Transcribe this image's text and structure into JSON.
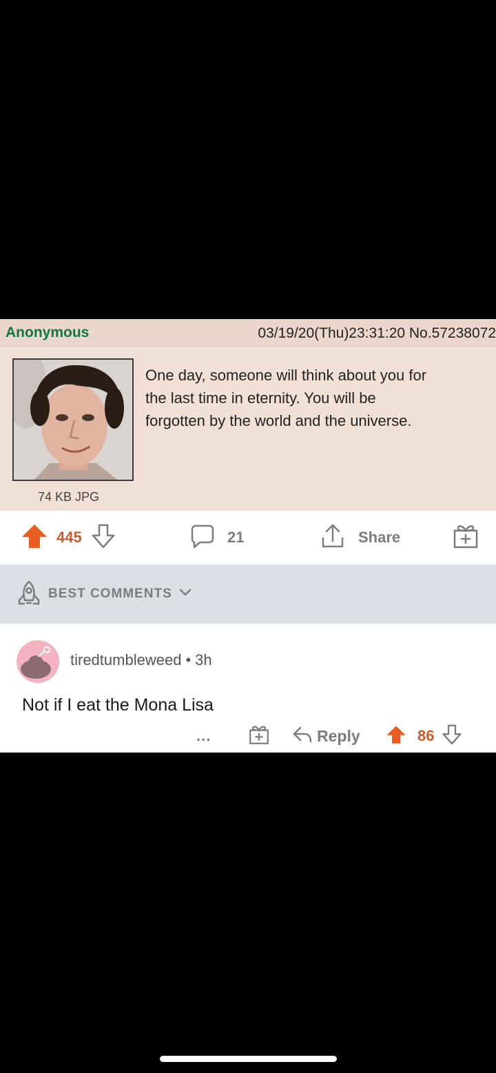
{
  "post": {
    "name": "Anonymous",
    "meta": "03/19/20(Thu)23:31:20 No.57238072",
    "text_lines": [
      "One day, someone will think about you for",
      "the last time in eternity. You will be",
      "forgotten by the world and the universe."
    ],
    "file_info": "74 KB JPG"
  },
  "actions": {
    "upvotes": "445",
    "comments": "21",
    "share_label": "Share",
    "upvote_color": "#cc5a2a"
  },
  "sort": {
    "label": "BEST COMMENTS"
  },
  "comment": {
    "username": "tiredtumbleweed",
    "separator": "•",
    "age": "3h",
    "body": "Not if I eat the Mona Lisa",
    "more": "...",
    "reply_label": "Reply",
    "votes": "86"
  },
  "icons": {
    "upvote": "arrow-up-icon",
    "downvote": "arrow-down-icon",
    "comment": "speech-bubble-icon",
    "share": "share-icon",
    "award": "gift-icon",
    "sort": "rocket-icon",
    "reply": "reply-arrow-icon"
  }
}
